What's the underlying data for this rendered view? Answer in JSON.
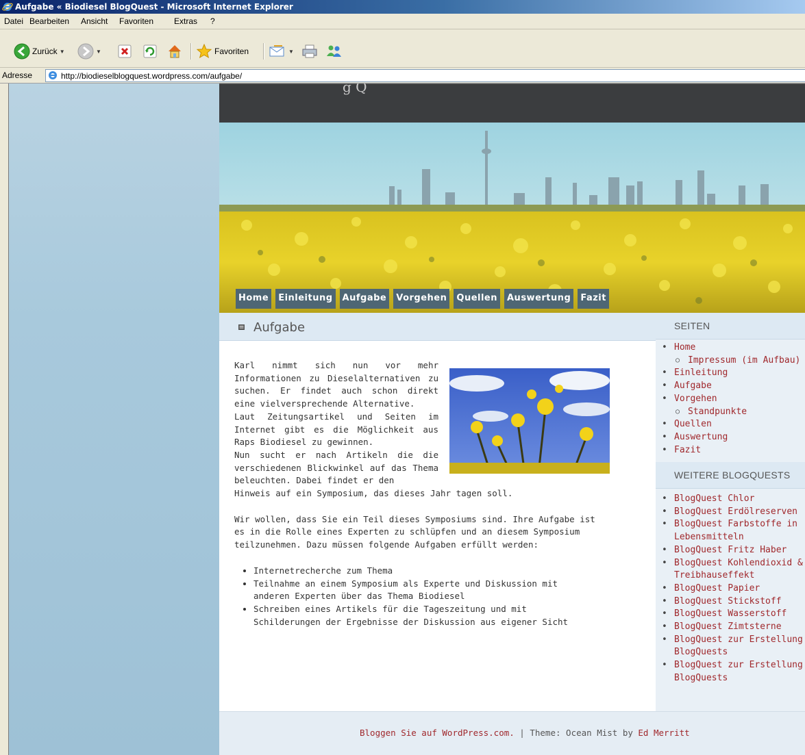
{
  "window": {
    "title": "Aufgabe « Biodiesel BlogQuest - Microsoft Internet Explorer"
  },
  "menu": [
    "Datei",
    "Bearbeiten",
    "Ansicht",
    "Favoriten",
    "Extras",
    "?"
  ],
  "toolbar": {
    "back_label": "Zurück",
    "favorites_label": "Favoriten"
  },
  "address": {
    "label": "Adresse",
    "url": "http://biodieselblogquest.wordpress.com/aufgabe/"
  },
  "nav": [
    "Home",
    "Einleitung",
    "Aufgabe",
    "Vorgehen",
    "Quellen",
    "Auswertung",
    "Fazit"
  ],
  "post": {
    "title": "Aufgabe",
    "intro": "Karl nimmt sich nun vor mehr Informationen zu Dieselalternativen zu suchen. Er findet auch schon direkt eine vielversprechende Alternative.",
    "para2": "Laut Zeitungsartikel und Seiten im Internet gibt es die Möglichkeit aus Raps Biodiesel zu gewinnen.",
    "para3": "Nun sucht er nach Artikeln die die verschiedenen Blickwinkel auf das Thema beleuchten. Dabei findet er den",
    "para3_cont": "Hinweis auf ein Symposium, das dieses Jahr tagen soll.",
    "para4": "Wir wollen, dass Sie ein Teil dieses Symposiums sind. Ihre Aufgabe ist es in die Rolle eines Experten zu schlüpfen und an diesem Symposium teilzunehmen. Dazu müssen folgende Aufgaben erfüllt werden:",
    "tasks": [
      "Internetrecherche zum Thema",
      "Teilnahme an einem Symposium als Experte und Diskussion mit anderen Experten über das Thema Biodiesel",
      "Schreiben eines Artikels für die Tageszeitung und mit Schilderungen der Ergebnisse der Diskussion aus eigener Sicht"
    ]
  },
  "sidebar": {
    "pages_heading": "SEITEN",
    "pages": {
      "home": "Home",
      "impressum": "Impressum (im Aufbau)",
      "einleitung": "Einleitung",
      "aufgabe": "Aufgabe",
      "vorgehen": "Vorgehen",
      "standpunkte": "Standpunkte",
      "quellen": "Quellen",
      "auswertung": "Auswertung",
      "fazit": "Fazit"
    },
    "more_heading": "WEITERE BLOGQUESTS",
    "more": {
      "chlor": "BlogQuest Chlor",
      "erdoel": "BlogQuest Erdölreserven",
      "farb1": "BlogQuest Farbstoffe in",
      "farb2": "Lebensmitteln",
      "haber": "BlogQuest Fritz Haber",
      "kohlen1": "BlogQuest Kohlendioxid &",
      "kohlen2": "Treibhauseffekt",
      "papier": "BlogQuest Papier",
      "stick": "BlogQuest Stickstoff",
      "wasser": "BlogQuest Wasserstoff",
      "zimt": "BlogQuest Zimtsterne",
      "erst1a": "BlogQuest zur Erstellung von",
      "erst1b": "BlogQuests",
      "erst2a": "BlogQuest zur Erstellung von",
      "erst2b": "BlogQuests"
    }
  },
  "footer": {
    "wp_link": "Bloggen Sie auf WordPress.com.",
    "sep": " | Theme: Ocean Mist by ",
    "author_link": "Ed Merritt"
  }
}
